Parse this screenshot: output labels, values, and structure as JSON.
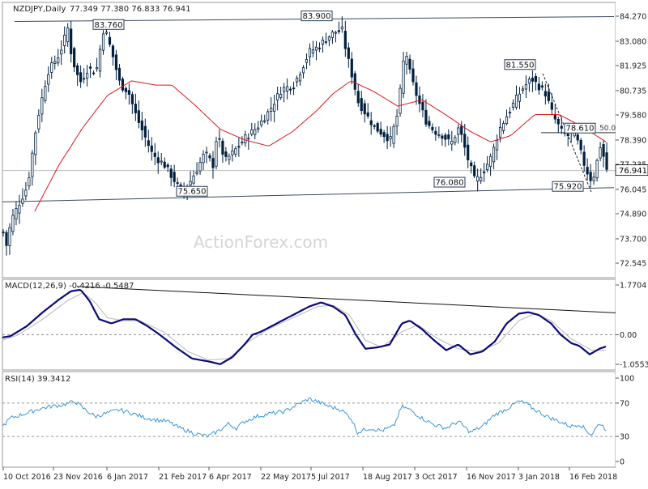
{
  "header": {
    "symbol": "NZDJPY,Daily",
    "ohlc": "77.349 77.380 76.833 76.941"
  },
  "watermark": "ActionForex.com",
  "colors": {
    "candles": "#002040",
    "ma": "#e0161b",
    "macd_line": "#0a0a78",
    "macd_signal": "#b8b8b8",
    "rsi": "#3a96d8",
    "trendline": "#3a4a60",
    "grid": "#9a9a9a"
  },
  "chart_data": [
    {
      "type": "candlestick",
      "panel": "price",
      "title": "",
      "ylim": [
        72.6,
        84.4
      ],
      "y_ticks": [
        "84.270",
        "83.080",
        "81.925",
        "80.735",
        "79.580",
        "78.390",
        "77.235",
        "76.045",
        "74.890",
        "73.700",
        "72.545"
      ],
      "x_ticks": [
        "10 Oct 2016",
        "23 Nov 2016",
        "6 Jan 2017",
        "21 Feb 2017",
        "6 Apr 2017",
        "22 May 2017",
        "5 Jul 2017",
        "18 Aug 2017",
        "3 Oct 2017",
        "16 Nov 2017",
        "3 Jan 2018",
        "16 Feb 2018"
      ],
      "current_price": {
        "label": "76.941",
        "value": 76.941
      },
      "levels": [
        {
          "label": "83.760",
          "value": 83.76
        },
        {
          "label": "83.900",
          "value": 83.9
        },
        {
          "label": "75.650",
          "value": 75.65
        },
        {
          "label": "76.080",
          "value": 76.08
        },
        {
          "label": "81.550",
          "value": 81.55
        },
        {
          "label": "78.610",
          "value": 78.61
        },
        {
          "label": "75.920",
          "value": 75.92
        },
        {
          "label": "50.0",
          "value": 78.74
        }
      ],
      "series_anchors": [
        [
          0,
          74.0
        ],
        [
          3,
          73.2
        ],
        [
          10,
          74.6
        ],
        [
          20,
          75.4
        ],
        [
          30,
          76.2
        ],
        [
          42,
          79.3
        ],
        [
          55,
          81.6
        ],
        [
          70,
          82.5
        ],
        [
          80,
          83.7
        ],
        [
          85,
          82.3
        ],
        [
          95,
          81.1
        ],
        [
          105,
          81.8
        ],
        [
          115,
          81.6
        ],
        [
          125,
          83.8
        ],
        [
          135,
          82.5
        ],
        [
          145,
          81.0
        ],
        [
          155,
          80.7
        ],
        [
          165,
          79.5
        ],
        [
          175,
          78.6
        ],
        [
          185,
          77.7
        ],
        [
          200,
          77.2
        ],
        [
          210,
          76.6
        ],
        [
          220,
          76.0
        ],
        [
          230,
          76.3
        ],
        [
          240,
          77.0
        ],
        [
          250,
          77.8
        ],
        [
          260,
          77.2
        ],
        [
          265,
          78.7
        ],
        [
          275,
          77.4
        ],
        [
          285,
          77.8
        ],
        [
          300,
          78.5
        ],
        [
          315,
          79.0
        ],
        [
          330,
          79.8
        ],
        [
          345,
          80.8
        ],
        [
          360,
          81.0
        ],
        [
          370,
          81.8
        ],
        [
          380,
          82.6
        ],
        [
          390,
          82.8
        ],
        [
          400,
          83.2
        ],
        [
          410,
          83.5
        ],
        [
          420,
          83.6
        ],
        [
          425,
          82.6
        ],
        [
          432,
          81.5
        ],
        [
          440,
          80.2
        ],
        [
          450,
          79.6
        ],
        [
          460,
          79.0
        ],
        [
          470,
          78.7
        ],
        [
          480,
          78.4
        ],
        [
          490,
          79.8
        ],
        [
          495,
          82.0
        ],
        [
          500,
          82.4
        ],
        [
          505,
          81.4
        ],
        [
          510,
          80.8
        ],
        [
          515,
          80.2
        ],
        [
          525,
          79.2
        ],
        [
          535,
          78.8
        ],
        [
          545,
          78.6
        ],
        [
          555,
          78.2
        ],
        [
          565,
          79.0
        ],
        [
          575,
          77.6
        ],
        [
          585,
          76.4
        ],
        [
          595,
          76.9
        ],
        [
          605,
          77.6
        ],
        [
          615,
          78.9
        ],
        [
          625,
          79.6
        ],
        [
          635,
          80.3
        ],
        [
          645,
          80.9
        ],
        [
          655,
          81.3
        ],
        [
          665,
          80.9
        ],
        [
          672,
          80.6
        ],
        [
          682,
          79.5
        ],
        [
          692,
          78.8
        ],
        [
          700,
          78.6
        ],
        [
          708,
          78.8
        ],
        [
          715,
          77.9
        ],
        [
          722,
          77.0
        ],
        [
          730,
          76.4
        ],
        [
          735,
          77.2
        ],
        [
          740,
          78.1
        ],
        [
          745,
          77.5
        ],
        [
          748,
          77.0
        ]
      ],
      "ma_anchors": [
        [
          40,
          75.0
        ],
        [
          70,
          77.2
        ],
        [
          100,
          79.0
        ],
        [
          130,
          80.5
        ],
        [
          160,
          81.2
        ],
        [
          190,
          81.0
        ],
        [
          210,
          81.0
        ],
        [
          240,
          80.0
        ],
        [
          270,
          78.9
        ],
        [
          300,
          78.4
        ],
        [
          330,
          78.1
        ],
        [
          360,
          78.8
        ],
        [
          390,
          79.8
        ],
        [
          410,
          80.6
        ],
        [
          432,
          81.2
        ],
        [
          460,
          80.7
        ],
        [
          490,
          80.0
        ],
        [
          520,
          80.3
        ],
        [
          545,
          79.7
        ],
        [
          580,
          78.8
        ],
        [
          605,
          78.3
        ],
        [
          630,
          78.6
        ],
        [
          660,
          79.6
        ],
        [
          690,
          79.6
        ],
        [
          720,
          79.0
        ],
        [
          748,
          78.3
        ]
      ]
    },
    {
      "type": "line",
      "panel": "macd",
      "title": "MACD(12,26,9) -0.4216 -0.5487",
      "ylim": [
        -1.35,
        1.95
      ],
      "y_ticks": [
        "1.7704",
        "0.00",
        "-1.0553"
      ],
      "macd_anchors": [
        [
          0,
          -0.1
        ],
        [
          10,
          -0.05
        ],
        [
          30,
          0.3
        ],
        [
          50,
          0.8
        ],
        [
          70,
          1.25
        ],
        [
          85,
          1.55
        ],
        [
          97,
          1.6
        ],
        [
          108,
          1.2
        ],
        [
          120,
          0.55
        ],
        [
          135,
          0.4
        ],
        [
          150,
          0.55
        ],
        [
          165,
          0.55
        ],
        [
          180,
          0.3
        ],
        [
          195,
          0.0
        ],
        [
          215,
          -0.45
        ],
        [
          235,
          -0.85
        ],
        [
          255,
          -0.95
        ],
        [
          270,
          -1.05
        ],
        [
          285,
          -0.8
        ],
        [
          300,
          -0.35
        ],
        [
          310,
          0.0
        ],
        [
          320,
          0.1
        ],
        [
          340,
          0.4
        ],
        [
          360,
          0.7
        ],
        [
          380,
          1.0
        ],
        [
          395,
          1.15
        ],
        [
          410,
          1.0
        ],
        [
          425,
          0.7
        ],
        [
          438,
          0.0
        ],
        [
          450,
          -0.5
        ],
        [
          465,
          -0.45
        ],
        [
          480,
          -0.35
        ],
        [
          495,
          0.4
        ],
        [
          505,
          0.5
        ],
        [
          520,
          0.2
        ],
        [
          535,
          -0.2
        ],
        [
          550,
          -0.55
        ],
        [
          565,
          -0.35
        ],
        [
          580,
          -0.7
        ],
        [
          595,
          -0.6
        ],
        [
          610,
          -0.25
        ],
        [
          625,
          0.4
        ],
        [
          640,
          0.75
        ],
        [
          652,
          0.8
        ],
        [
          665,
          0.7
        ],
        [
          680,
          0.4
        ],
        [
          692,
          0.0
        ],
        [
          705,
          -0.3
        ],
        [
          715,
          -0.4
        ],
        [
          728,
          -0.7
        ],
        [
          740,
          -0.5
        ],
        [
          748,
          -0.42
        ]
      ],
      "signal_anchors": [
        [
          0,
          -0.2
        ],
        [
          20,
          0.0
        ],
        [
          50,
          0.55
        ],
        [
          80,
          1.2
        ],
        [
          100,
          1.5
        ],
        [
          115,
          1.15
        ],
        [
          130,
          0.6
        ],
        [
          150,
          0.5
        ],
        [
          170,
          0.5
        ],
        [
          200,
          0.1
        ],
        [
          230,
          -0.6
        ],
        [
          255,
          -0.9
        ],
        [
          280,
          -0.85
        ],
        [
          305,
          -0.25
        ],
        [
          330,
          0.2
        ],
        [
          360,
          0.6
        ],
        [
          390,
          1.0
        ],
        [
          410,
          1.05
        ],
        [
          430,
          0.7
        ],
        [
          450,
          -0.2
        ],
        [
          470,
          -0.45
        ],
        [
          495,
          0.1
        ],
        [
          515,
          0.35
        ],
        [
          540,
          -0.15
        ],
        [
          565,
          -0.5
        ],
        [
          590,
          -0.6
        ],
        [
          615,
          -0.3
        ],
        [
          640,
          0.5
        ],
        [
          660,
          0.75
        ],
        [
          680,
          0.5
        ],
        [
          705,
          -0.15
        ],
        [
          730,
          -0.55
        ],
        [
          748,
          -0.55
        ]
      ],
      "zero_line": 0.0,
      "trendline": "descending from Nov 2016 peak"
    },
    {
      "type": "line",
      "panel": "rsi",
      "title": "RSI(14) 39.3412",
      "ylim": [
        0,
        100
      ],
      "y_ticks": [
        "100",
        "70",
        "30",
        "0"
      ],
      "levels": [
        70,
        30
      ],
      "rsi_anchors": [
        [
          0,
          42
        ],
        [
          10,
          52
        ],
        [
          20,
          55
        ],
        [
          30,
          58
        ],
        [
          45,
          63
        ],
        [
          60,
          66
        ],
        [
          75,
          68
        ],
        [
          90,
          72
        ],
        [
          100,
          64
        ],
        [
          115,
          54
        ],
        [
          130,
          58
        ],
        [
          145,
          62
        ],
        [
          160,
          58
        ],
        [
          175,
          53
        ],
        [
          190,
          50
        ],
        [
          205,
          48
        ],
        [
          220,
          40
        ],
        [
          240,
          33
        ],
        [
          255,
          30
        ],
        [
          270,
          38
        ],
        [
          280,
          45
        ],
        [
          290,
          40
        ],
        [
          300,
          48
        ],
        [
          315,
          54
        ],
        [
          330,
          57
        ],
        [
          350,
          60
        ],
        [
          365,
          68
        ],
        [
          380,
          75
        ],
        [
          390,
          72
        ],
        [
          405,
          66
        ],
        [
          420,
          62
        ],
        [
          432,
          52
        ],
        [
          440,
          35
        ],
        [
          455,
          40
        ],
        [
          470,
          37
        ],
        [
          485,
          42
        ],
        [
          495,
          66
        ],
        [
          505,
          62
        ],
        [
          520,
          52
        ],
        [
          535,
          44
        ],
        [
          550,
          40
        ],
        [
          565,
          48
        ],
        [
          580,
          35
        ],
        [
          595,
          42
        ],
        [
          610,
          56
        ],
        [
          625,
          63
        ],
        [
          640,
          72
        ],
        [
          648,
          70
        ],
        [
          660,
          62
        ],
        [
          675,
          54
        ],
        [
          690,
          48
        ],
        [
          705,
          42
        ],
        [
          715,
          45
        ],
        [
          730,
          32
        ],
        [
          740,
          46
        ],
        [
          748,
          39
        ]
      ]
    }
  ]
}
